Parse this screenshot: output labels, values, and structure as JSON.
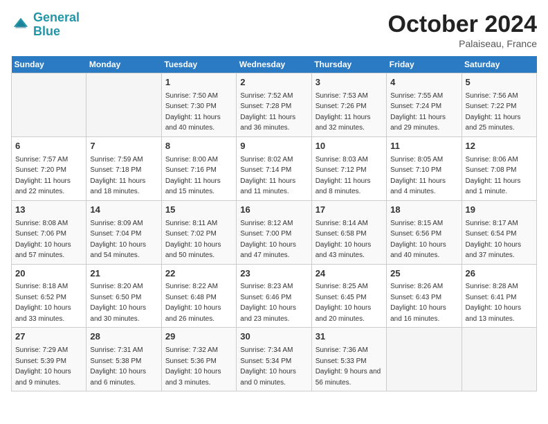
{
  "app": {
    "logo_line1": "General",
    "logo_line2": "Blue",
    "month": "October 2024",
    "location": "Palaiseau, France"
  },
  "days_of_week": [
    "Sunday",
    "Monday",
    "Tuesday",
    "Wednesday",
    "Thursday",
    "Friday",
    "Saturday"
  ],
  "weeks": [
    [
      {
        "day": "",
        "sunrise": "",
        "sunset": "",
        "daylight": "",
        "empty": true
      },
      {
        "day": "",
        "sunrise": "",
        "sunset": "",
        "daylight": "",
        "empty": true
      },
      {
        "day": "1",
        "sunrise": "Sunrise: 7:50 AM",
        "sunset": "Sunset: 7:30 PM",
        "daylight": "Daylight: 11 hours and 40 minutes.",
        "empty": false
      },
      {
        "day": "2",
        "sunrise": "Sunrise: 7:52 AM",
        "sunset": "Sunset: 7:28 PM",
        "daylight": "Daylight: 11 hours and 36 minutes.",
        "empty": false
      },
      {
        "day": "3",
        "sunrise": "Sunrise: 7:53 AM",
        "sunset": "Sunset: 7:26 PM",
        "daylight": "Daylight: 11 hours and 32 minutes.",
        "empty": false
      },
      {
        "day": "4",
        "sunrise": "Sunrise: 7:55 AM",
        "sunset": "Sunset: 7:24 PM",
        "daylight": "Daylight: 11 hours and 29 minutes.",
        "empty": false
      },
      {
        "day": "5",
        "sunrise": "Sunrise: 7:56 AM",
        "sunset": "Sunset: 7:22 PM",
        "daylight": "Daylight: 11 hours and 25 minutes.",
        "empty": false
      }
    ],
    [
      {
        "day": "6",
        "sunrise": "Sunrise: 7:57 AM",
        "sunset": "Sunset: 7:20 PM",
        "daylight": "Daylight: 11 hours and 22 minutes.",
        "empty": false
      },
      {
        "day": "7",
        "sunrise": "Sunrise: 7:59 AM",
        "sunset": "Sunset: 7:18 PM",
        "daylight": "Daylight: 11 hours and 18 minutes.",
        "empty": false
      },
      {
        "day": "8",
        "sunrise": "Sunrise: 8:00 AM",
        "sunset": "Sunset: 7:16 PM",
        "daylight": "Daylight: 11 hours and 15 minutes.",
        "empty": false
      },
      {
        "day": "9",
        "sunrise": "Sunrise: 8:02 AM",
        "sunset": "Sunset: 7:14 PM",
        "daylight": "Daylight: 11 hours and 11 minutes.",
        "empty": false
      },
      {
        "day": "10",
        "sunrise": "Sunrise: 8:03 AM",
        "sunset": "Sunset: 7:12 PM",
        "daylight": "Daylight: 11 hours and 8 minutes.",
        "empty": false
      },
      {
        "day": "11",
        "sunrise": "Sunrise: 8:05 AM",
        "sunset": "Sunset: 7:10 PM",
        "daylight": "Daylight: 11 hours and 4 minutes.",
        "empty": false
      },
      {
        "day": "12",
        "sunrise": "Sunrise: 8:06 AM",
        "sunset": "Sunset: 7:08 PM",
        "daylight": "Daylight: 11 hours and 1 minute.",
        "empty": false
      }
    ],
    [
      {
        "day": "13",
        "sunrise": "Sunrise: 8:08 AM",
        "sunset": "Sunset: 7:06 PM",
        "daylight": "Daylight: 10 hours and 57 minutes.",
        "empty": false
      },
      {
        "day": "14",
        "sunrise": "Sunrise: 8:09 AM",
        "sunset": "Sunset: 7:04 PM",
        "daylight": "Daylight: 10 hours and 54 minutes.",
        "empty": false
      },
      {
        "day": "15",
        "sunrise": "Sunrise: 8:11 AM",
        "sunset": "Sunset: 7:02 PM",
        "daylight": "Daylight: 10 hours and 50 minutes.",
        "empty": false
      },
      {
        "day": "16",
        "sunrise": "Sunrise: 8:12 AM",
        "sunset": "Sunset: 7:00 PM",
        "daylight": "Daylight: 10 hours and 47 minutes.",
        "empty": false
      },
      {
        "day": "17",
        "sunrise": "Sunrise: 8:14 AM",
        "sunset": "Sunset: 6:58 PM",
        "daylight": "Daylight: 10 hours and 43 minutes.",
        "empty": false
      },
      {
        "day": "18",
        "sunrise": "Sunrise: 8:15 AM",
        "sunset": "Sunset: 6:56 PM",
        "daylight": "Daylight: 10 hours and 40 minutes.",
        "empty": false
      },
      {
        "day": "19",
        "sunrise": "Sunrise: 8:17 AM",
        "sunset": "Sunset: 6:54 PM",
        "daylight": "Daylight: 10 hours and 37 minutes.",
        "empty": false
      }
    ],
    [
      {
        "day": "20",
        "sunrise": "Sunrise: 8:18 AM",
        "sunset": "Sunset: 6:52 PM",
        "daylight": "Daylight: 10 hours and 33 minutes.",
        "empty": false
      },
      {
        "day": "21",
        "sunrise": "Sunrise: 8:20 AM",
        "sunset": "Sunset: 6:50 PM",
        "daylight": "Daylight: 10 hours and 30 minutes.",
        "empty": false
      },
      {
        "day": "22",
        "sunrise": "Sunrise: 8:22 AM",
        "sunset": "Sunset: 6:48 PM",
        "daylight": "Daylight: 10 hours and 26 minutes.",
        "empty": false
      },
      {
        "day": "23",
        "sunrise": "Sunrise: 8:23 AM",
        "sunset": "Sunset: 6:46 PM",
        "daylight": "Daylight: 10 hours and 23 minutes.",
        "empty": false
      },
      {
        "day": "24",
        "sunrise": "Sunrise: 8:25 AM",
        "sunset": "Sunset: 6:45 PM",
        "daylight": "Daylight: 10 hours and 20 minutes.",
        "empty": false
      },
      {
        "day": "25",
        "sunrise": "Sunrise: 8:26 AM",
        "sunset": "Sunset: 6:43 PM",
        "daylight": "Daylight: 10 hours and 16 minutes.",
        "empty": false
      },
      {
        "day": "26",
        "sunrise": "Sunrise: 8:28 AM",
        "sunset": "Sunset: 6:41 PM",
        "daylight": "Daylight: 10 hours and 13 minutes.",
        "empty": false
      }
    ],
    [
      {
        "day": "27",
        "sunrise": "Sunrise: 7:29 AM",
        "sunset": "Sunset: 5:39 PM",
        "daylight": "Daylight: 10 hours and 9 minutes.",
        "empty": false
      },
      {
        "day": "28",
        "sunrise": "Sunrise: 7:31 AM",
        "sunset": "Sunset: 5:38 PM",
        "daylight": "Daylight: 10 hours and 6 minutes.",
        "empty": false
      },
      {
        "day": "29",
        "sunrise": "Sunrise: 7:32 AM",
        "sunset": "Sunset: 5:36 PM",
        "daylight": "Daylight: 10 hours and 3 minutes.",
        "empty": false
      },
      {
        "day": "30",
        "sunrise": "Sunrise: 7:34 AM",
        "sunset": "Sunset: 5:34 PM",
        "daylight": "Daylight: 10 hours and 0 minutes.",
        "empty": false
      },
      {
        "day": "31",
        "sunrise": "Sunrise: 7:36 AM",
        "sunset": "Sunset: 5:33 PM",
        "daylight": "Daylight: 9 hours and 56 minutes.",
        "empty": false
      },
      {
        "day": "",
        "sunrise": "",
        "sunset": "",
        "daylight": "",
        "empty": true
      },
      {
        "day": "",
        "sunrise": "",
        "sunset": "",
        "daylight": "",
        "empty": true
      }
    ]
  ]
}
